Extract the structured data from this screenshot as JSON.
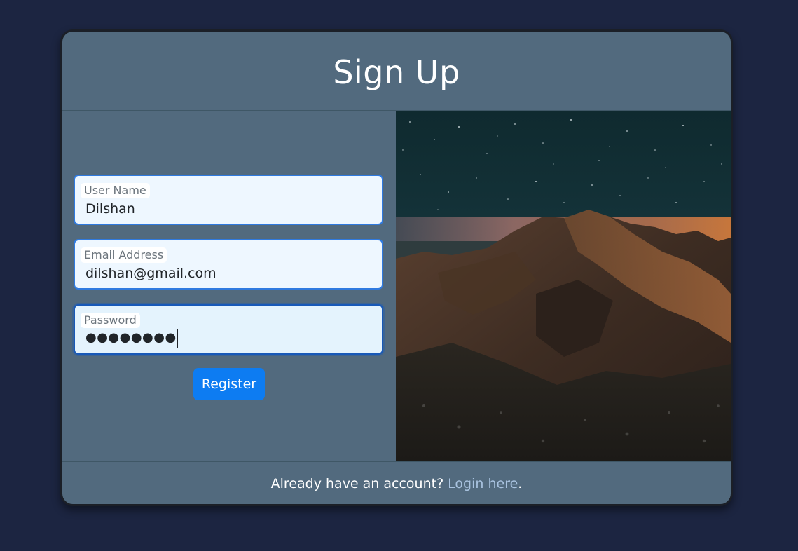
{
  "header": {
    "title": "Sign Up"
  },
  "form": {
    "username": {
      "label": "User Name",
      "value": "Dilshan"
    },
    "email": {
      "label": "Email Address",
      "value": "dilshan@gmail.com"
    },
    "password": {
      "label": "Password",
      "masked_value": "●●●●●●●●"
    },
    "register_label": "Register"
  },
  "image": {
    "icon": "mountain-night-sky-photo"
  },
  "footer": {
    "prompt": "Already have an account?",
    "link_text": "Login here",
    "suffix": "."
  },
  "colors": {
    "background": "#1c2541",
    "card": "#526a7e",
    "primary": "#0d7cf2",
    "field_border": "#2f7ae0",
    "link": "#a9c3e0"
  }
}
